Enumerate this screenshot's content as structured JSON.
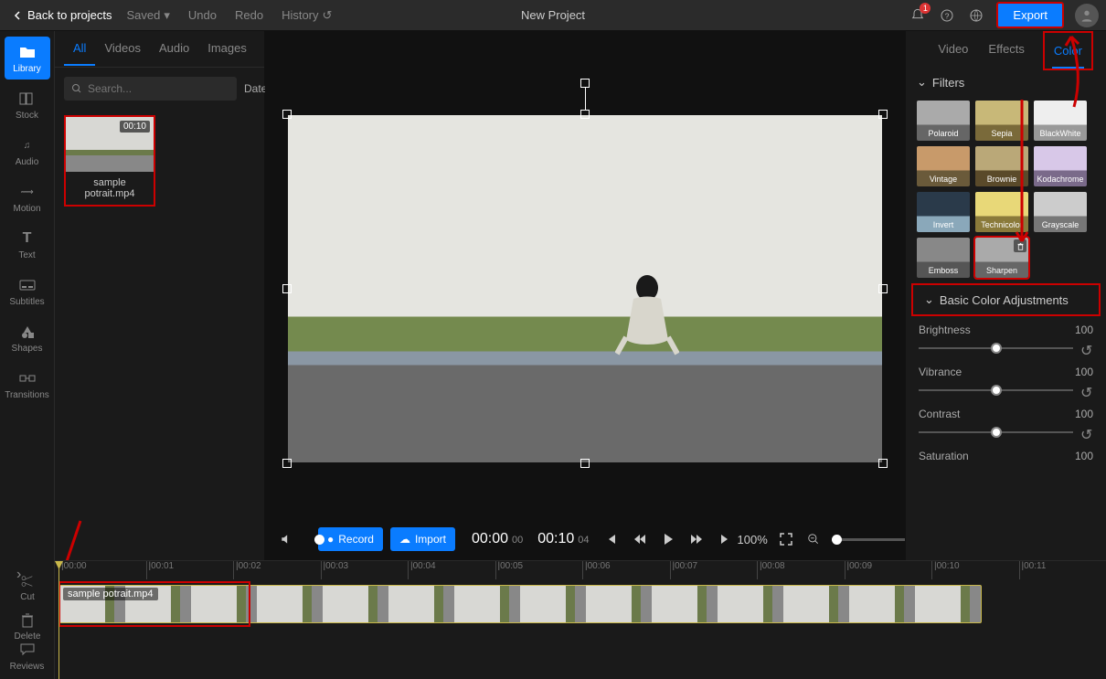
{
  "topbar": {
    "back": "Back to projects",
    "saved": "Saved",
    "undo": "Undo",
    "redo": "Redo",
    "history": "History",
    "title": "New Project",
    "notif_count": "1",
    "export": "Export"
  },
  "leftbar": {
    "library": "Library",
    "stock": "Stock",
    "audio": "Audio",
    "motion": "Motion",
    "text": "Text",
    "subtitles": "Subtitles",
    "shapes": "Shapes",
    "transitions": "Transitions",
    "reviews": "Reviews"
  },
  "library": {
    "tabs": {
      "all": "All",
      "videos": "Videos",
      "audio": "Audio",
      "images": "Images"
    },
    "search_placeholder": "Search...",
    "sort": "Date",
    "media": {
      "duration": "00:10",
      "name": "sample potrait.mp4"
    }
  },
  "controls": {
    "record": "Record",
    "import": "Import",
    "current": "00:00",
    "current_frames": "00",
    "total": "00:10",
    "total_frames": "04",
    "zoom": "100%"
  },
  "rightpanel": {
    "tabs": {
      "video": "Video",
      "effects": "Effects",
      "color": "Color"
    },
    "filters_head": "Filters",
    "filters": [
      "Polaroid",
      "Sepia",
      "BlackWhite",
      "Vintage",
      "Brownie",
      "Kodachrome",
      "Invert",
      "Technicolor",
      "Grayscale",
      "Emboss",
      "Sharpen"
    ],
    "basic_head": "Basic Color Adjustments",
    "adj": {
      "brightness": {
        "label": "Brightness",
        "value": "100"
      },
      "vibrance": {
        "label": "Vibrance",
        "value": "100"
      },
      "contrast": {
        "label": "Contrast",
        "value": "100"
      },
      "saturation": {
        "label": "Saturation",
        "value": "100"
      }
    }
  },
  "timeline": {
    "ticks": [
      "|00:00",
      "|00:01",
      "|00:02",
      "|00:03",
      "|00:04",
      "|00:05",
      "|00:06",
      "|00:07",
      "|00:08",
      "|00:09",
      "|00:10",
      "|00:11"
    ],
    "clip_name": "sample potrait.mp4",
    "tools": {
      "cut": "Cut",
      "delete": "Delete"
    }
  }
}
